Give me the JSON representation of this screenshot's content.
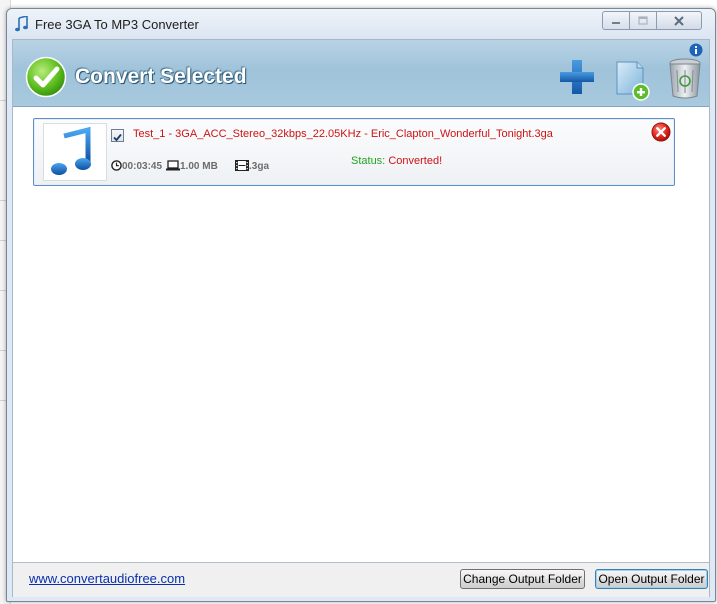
{
  "window": {
    "title": "Free 3GA To MP3 Converter",
    "app_icon": "music-note-icon",
    "controls": [
      "minimize-icon",
      "maximize-icon",
      "close-icon"
    ]
  },
  "toolbar": {
    "convert_label": "Convert Selected",
    "convert_icon": "green-check-icon",
    "info_icon": "info-icon",
    "tools": [
      "add-file-icon",
      "add-folder-icon",
      "recycle-bin-icon"
    ]
  },
  "file_list": [
    {
      "checked": true,
      "name": "Test_1 - 3GA_ACC_Stereo_32kbps_22.05KHz - Eric_Clapton_Wonderful_Tonight.3ga",
      "duration": "00:03:45",
      "size": "1.00 MB",
      "format": ".3ga",
      "status_label": "Status:",
      "status_value": "Converted!"
    }
  ],
  "footer": {
    "link": "www.convertaudiofree.com",
    "change_folder_label": "Change Output Folder",
    "open_folder_label": "Open Output Folder"
  },
  "colors": {
    "header_band": "#a8c9de",
    "file_name": "#cc1414",
    "status_label": "#22a422",
    "link": "#0b2fae",
    "item_border": "#5f8fc5"
  }
}
